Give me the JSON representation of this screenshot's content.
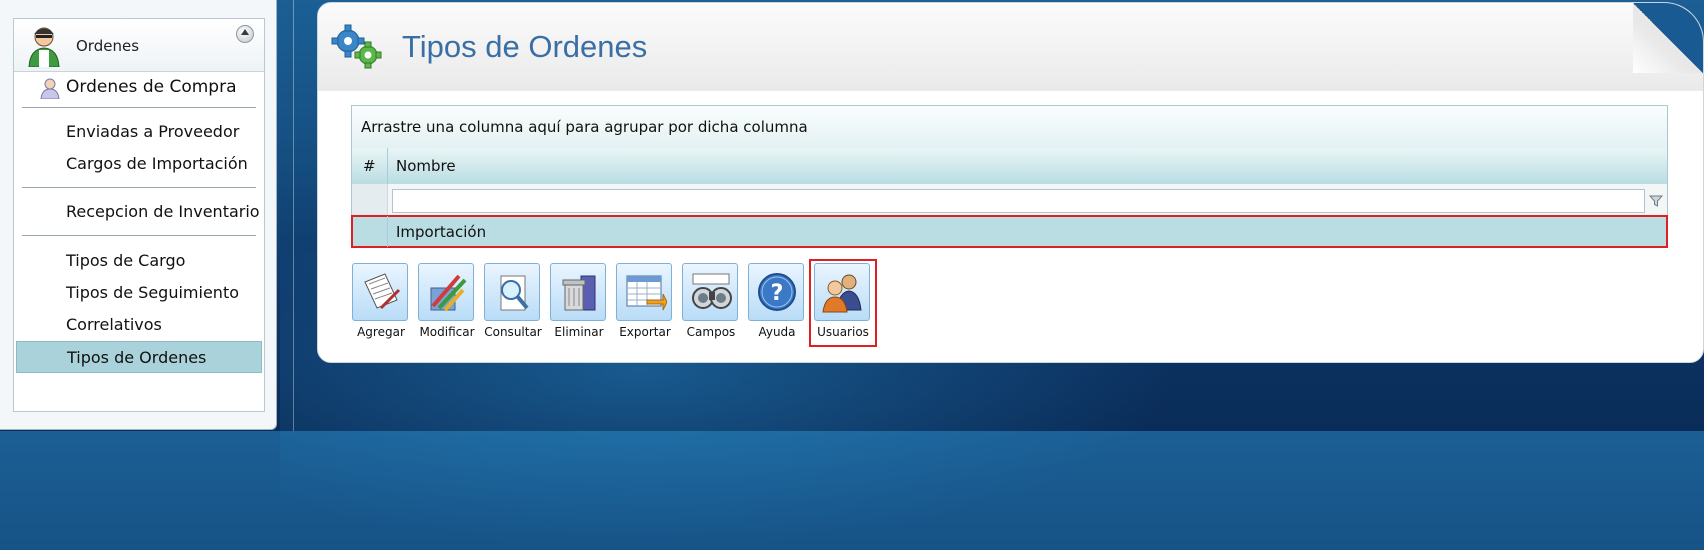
{
  "sidebar": {
    "section_title": "Ordenes",
    "primary_item": "Ordenes de Compra",
    "items": [
      "Enviadas a Proveedor",
      "Cargos de Importación",
      "Recepcion de Inventario",
      "Tipos de Cargo",
      "Tipos de Seguimiento",
      "Correlativos",
      "Tipos de Ordenes"
    ],
    "selected": "Tipos de Ordenes"
  },
  "main": {
    "title": "Tipos de Ordenes"
  },
  "grid": {
    "group_hint": "Arrastre una columna aquí para agrupar por dicha columna",
    "columns": [
      "#",
      "Nombre"
    ],
    "filter_value": "",
    "rows": [
      {
        "nombre": "Importación"
      }
    ]
  },
  "toolbar": {
    "buttons": [
      "Agregar",
      "Modificar",
      "Consultar",
      "Eliminar",
      "Exportar",
      "Campos",
      "Ayuda",
      "Usuarios"
    ]
  },
  "colors": {
    "accent_title": "#3a6fa5",
    "row_selected": "#b9dde2",
    "highlight_border": "#e02020"
  }
}
